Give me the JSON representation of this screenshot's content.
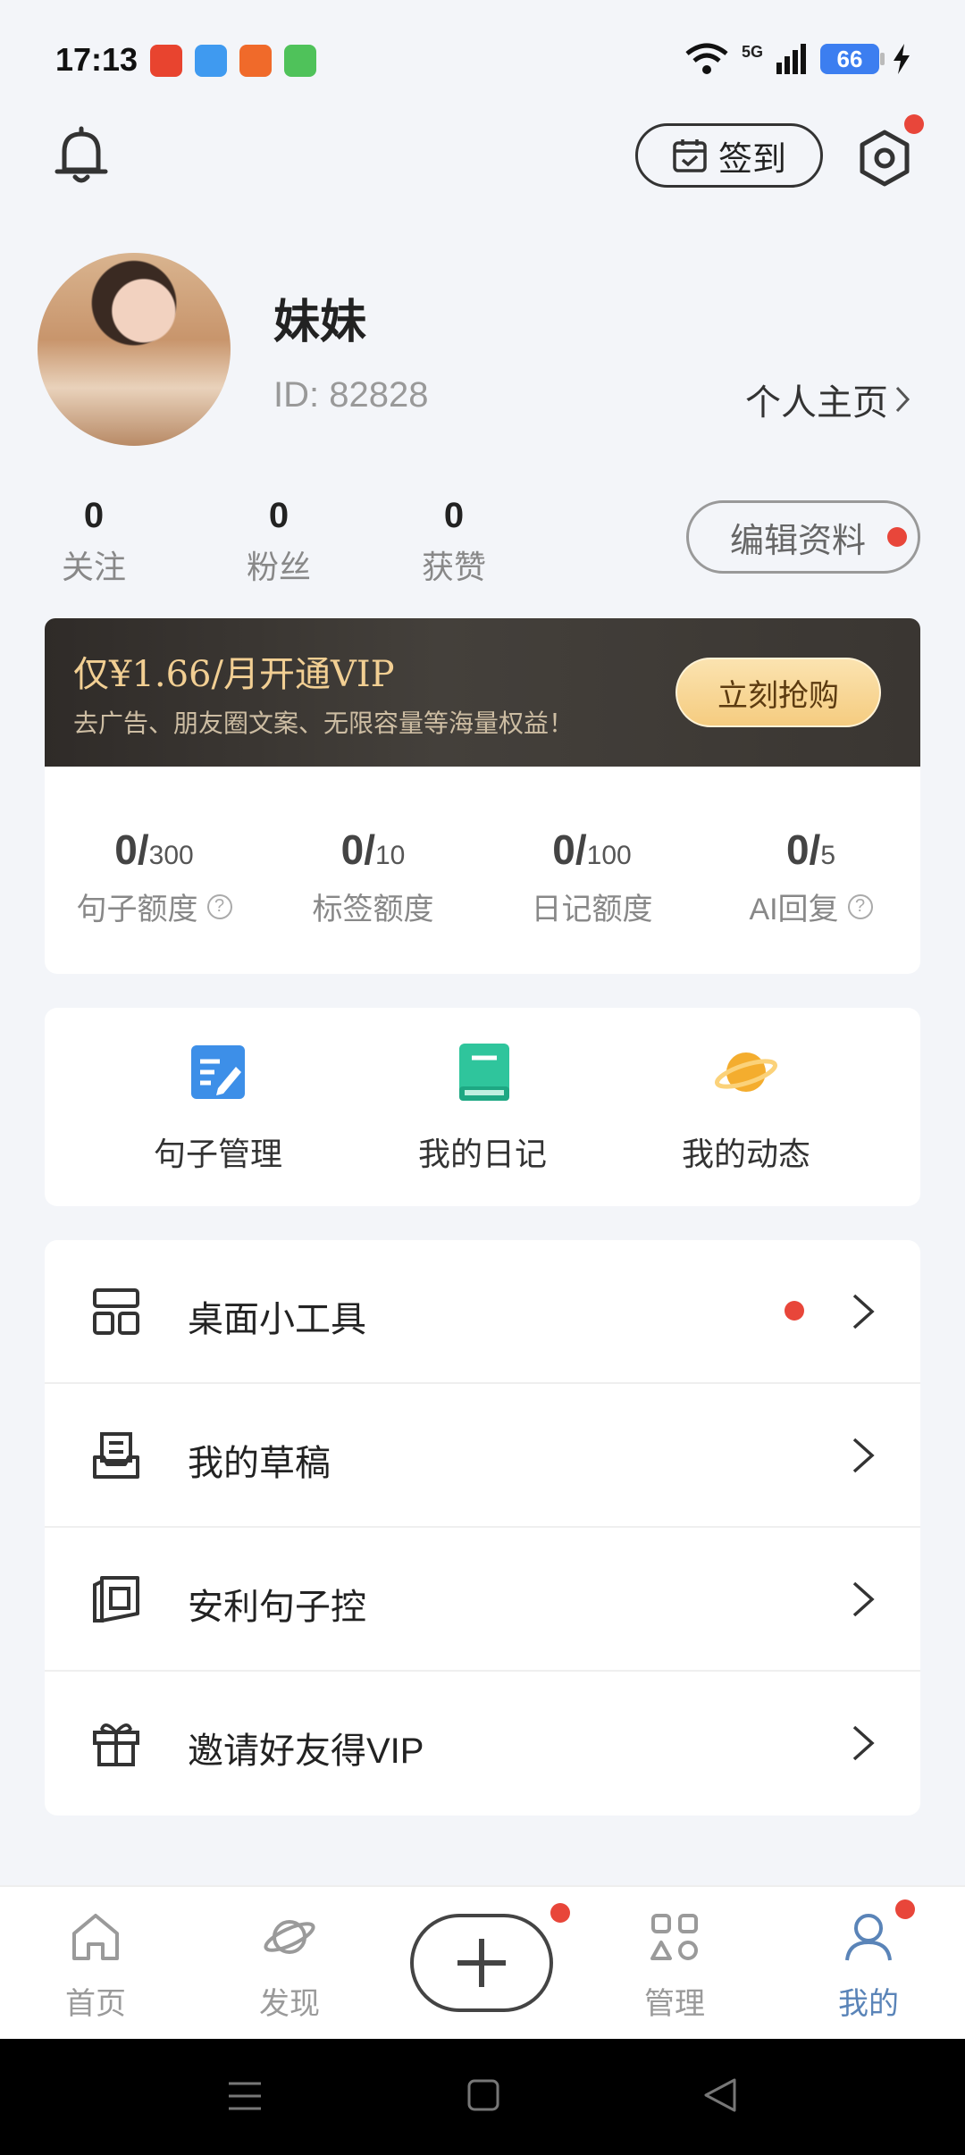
{
  "status": {
    "time": "17:13",
    "network": "5G",
    "battery": "66"
  },
  "header": {
    "signin_label": "签到"
  },
  "profile": {
    "name": "妹妹",
    "id_text": "ID: 82828",
    "homepage_label": "个人主页",
    "edit_label": "编辑资料",
    "stats": [
      {
        "value": "0",
        "label": "关注"
      },
      {
        "value": "0",
        "label": "粉丝"
      },
      {
        "value": "0",
        "label": "获赞"
      }
    ]
  },
  "vip": {
    "title": "仅¥1.66/月开通VIP",
    "subtitle": "去广告、朋友圈文案、无限容量等海量权益！",
    "buy_label": "立刻抢购"
  },
  "quotas": [
    {
      "used": "0/",
      "total": "300",
      "label": "句子额度",
      "help": "?"
    },
    {
      "used": "0/",
      "total": "10",
      "label": "标签额度",
      "help": ""
    },
    {
      "used": "0/",
      "total": "100",
      "label": "日记额度",
      "help": ""
    },
    {
      "used": "0/",
      "total": "5",
      "label": "AI回复",
      "help": "?"
    }
  ],
  "shortcuts": [
    {
      "label": "句子管理",
      "icon": "edit-doc-icon",
      "color": "#3d8fe8"
    },
    {
      "label": "我的日记",
      "icon": "diary-book-icon",
      "color": "#2fc59c"
    },
    {
      "label": "我的动态",
      "icon": "planet-icon",
      "color": "#f4ad2e"
    }
  ],
  "menu": [
    {
      "label": "桌面小工具",
      "icon": "widget-icon",
      "badge": true
    },
    {
      "label": "我的草稿",
      "icon": "draft-icon",
      "badge": false
    },
    {
      "label": "安利句子控",
      "icon": "share-app-icon",
      "badge": false
    },
    {
      "label": "邀请好友得VIP",
      "icon": "gift-icon",
      "badge": false
    }
  ],
  "nav": [
    {
      "label": "首页",
      "icon": "home-icon"
    },
    {
      "label": "发现",
      "icon": "discover-planet-icon"
    },
    {
      "label": "管理",
      "icon": "manage-grid-icon"
    },
    {
      "label": "我的",
      "icon": "profile-user-icon"
    }
  ],
  "colors": {
    "badge": "#e8463a",
    "active_nav": "#5a84b8",
    "vip_gold": "#f2cf93"
  }
}
